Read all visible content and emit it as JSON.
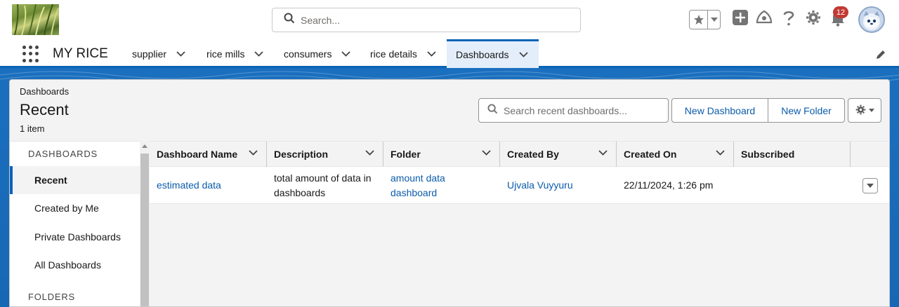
{
  "header": {
    "search_placeholder": "Search...",
    "notification_count": "12",
    "icons": [
      "logo-image",
      "search-icon",
      "star-icon",
      "chevron-down-icon",
      "add-icon",
      "trailhead-icon",
      "help-icon",
      "gear-icon",
      "bell-icon",
      "avatar-icon"
    ]
  },
  "nav": {
    "app_name": "MY RICE",
    "tabs": [
      {
        "label": "supplier",
        "active": false
      },
      {
        "label": "rice mills",
        "active": false
      },
      {
        "label": "consumers",
        "active": false
      },
      {
        "label": "rice details",
        "active": false
      },
      {
        "label": "Dashboards",
        "active": true
      }
    ]
  },
  "page": {
    "breadcrumb": "Dashboards",
    "title": "Recent",
    "item_count": "1 item",
    "search_placeholder": "Search recent dashboards...",
    "new_dashboard_label": "New Dashboard",
    "new_folder_label": "New Folder"
  },
  "sidebar": {
    "section_dashboards": "DASHBOARDS",
    "items": [
      {
        "label": "Recent",
        "active": true
      },
      {
        "label": "Created by Me",
        "active": false
      },
      {
        "label": "Private Dashboards",
        "active": false
      },
      {
        "label": "All Dashboards",
        "active": false
      }
    ],
    "section_folders": "FOLDERS"
  },
  "table": {
    "columns": [
      "Dashboard Name",
      "Description",
      "Folder",
      "Created By",
      "Created On",
      "Subscribed"
    ],
    "rows": [
      {
        "name": "estimated data",
        "description": "total amount of data in dashboards",
        "folder": "amount data dashboard",
        "created_by": "Ujvala Vuyyuru",
        "created_on": "22/11/2024, 1:26 pm",
        "subscribed": ""
      }
    ]
  },
  "colors": {
    "brand_blue": "#0a63b8",
    "link": "#0b5cab",
    "badge": "#c23934"
  }
}
